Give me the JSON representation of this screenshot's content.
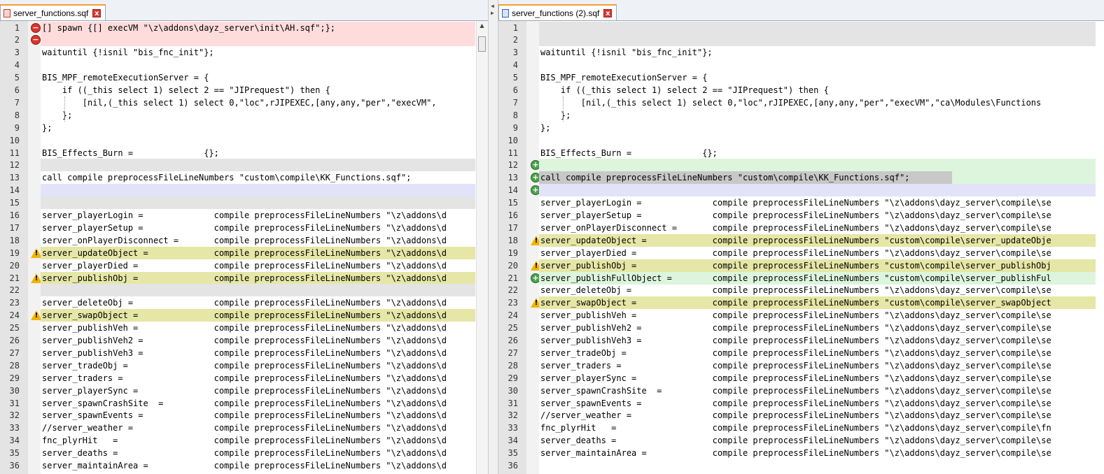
{
  "left": {
    "tab": {
      "title": "server_functions.sqf",
      "icon": "file-unsaved-icon",
      "close": "x"
    },
    "lines": [
      {
        "n": "1",
        "text": "[] spawn {[] execVM \"\\z\\addons\\dayz_server\\init\\AH.sqf\";};",
        "status": "deleted"
      },
      {
        "n": "2",
        "text": "",
        "status": "deleted"
      },
      {
        "n": "3",
        "text": "waituntil {!isnil \"bis_fnc_init\"};",
        "status": ""
      },
      {
        "n": "4",
        "text": "",
        "status": ""
      },
      {
        "n": "5",
        "text": "BIS_MPF_remoteExecutionServer = {",
        "status": ""
      },
      {
        "n": "6",
        "text": "    if ((_this select 1) select 2 == \"JIPrequest\") then {",
        "status": ""
      },
      {
        "n": "7",
        "text": "        [nil,(_this select 1) select 0,\"loc\",rJIPEXEC,[any,any,\"per\",\"execVM\",",
        "status": ""
      },
      {
        "n": "8",
        "text": "    };",
        "status": ""
      },
      {
        "n": "9",
        "text": "};",
        "status": ""
      },
      {
        "n": "10",
        "text": "",
        "status": ""
      },
      {
        "n": "11",
        "text": "BIS_Effects_Burn =              {};",
        "status": ""
      },
      {
        "n": "12",
        "text": "",
        "status": "blank"
      },
      {
        "n": "13",
        "text": "call compile preprocessFileLineNumbers \"custom\\compile\\KK_Functions.sqf\";",
        "status": ""
      },
      {
        "n": "14",
        "text": "",
        "status": "moved"
      },
      {
        "n": "15",
        "text": "",
        "status": "blank"
      },
      {
        "n": "16",
        "text": "server_playerLogin =              compile preprocessFileLineNumbers \"\\z\\addons\\d",
        "status": ""
      },
      {
        "n": "17",
        "text": "server_playerSetup =              compile preprocessFileLineNumbers \"\\z\\addons\\d",
        "status": ""
      },
      {
        "n": "18",
        "text": "server_onPlayerDisconnect =       compile preprocessFileLineNumbers \"\\z\\addons\\d",
        "status": ""
      },
      {
        "n": "19",
        "text": "server_updateObject =             compile preprocessFileLineNumbers \"\\z\\addons\\d",
        "status": "changed"
      },
      {
        "n": "20",
        "text": "server_playerDied =               compile preprocessFileLineNumbers \"\\z\\addons\\d",
        "status": ""
      },
      {
        "n": "21",
        "text": "server_publishObj =               compile preprocessFileLineNumbers \"\\z\\addons\\d",
        "status": "changed"
      },
      {
        "n": "22",
        "text": "",
        "status": "blank"
      },
      {
        "n": "23",
        "text": "server_deleteObj =                compile preprocessFileLineNumbers \"\\z\\addons\\d",
        "status": ""
      },
      {
        "n": "24",
        "text": "server_swapObject =               compile preprocessFileLineNumbers \"\\z\\addons\\d",
        "status": "changed"
      },
      {
        "n": "25",
        "text": "server_publishVeh =               compile preprocessFileLineNumbers \"\\z\\addons\\d",
        "status": ""
      },
      {
        "n": "26",
        "text": "server_publishVeh2 =              compile preprocessFileLineNumbers \"\\z\\addons\\d",
        "status": ""
      },
      {
        "n": "27",
        "text": "server_publishVeh3 =              compile preprocessFileLineNumbers \"\\z\\addons\\d",
        "status": ""
      },
      {
        "n": "28",
        "text": "server_tradeObj =                 compile preprocessFileLineNumbers \"\\z\\addons\\d",
        "status": ""
      },
      {
        "n": "29",
        "text": "server_traders =                  compile preprocessFileLineNumbers \"\\z\\addons\\d",
        "status": ""
      },
      {
        "n": "30",
        "text": "server_playerSync =               compile preprocessFileLineNumbers \"\\z\\addons\\d",
        "status": ""
      },
      {
        "n": "31",
        "text": "server_spawnCrashSite  =          compile preprocessFileLineNumbers \"\\z\\addons\\d",
        "status": ""
      },
      {
        "n": "32",
        "text": "server_spawnEvents =              compile preprocessFileLineNumbers \"\\z\\addons\\d",
        "status": ""
      },
      {
        "n": "33",
        "text": "//server_weather =                compile preprocessFileLineNumbers \"\\z\\addons\\d",
        "status": ""
      },
      {
        "n": "34",
        "text": "fnc_plyrHit   =                   compile preprocessFileLineNumbers \"\\z\\addons\\d",
        "status": ""
      },
      {
        "n": "35",
        "text": "server_deaths =                   compile preprocessFileLineNumbers \"\\z\\addons\\d",
        "status": ""
      },
      {
        "n": "36",
        "text": "server_maintainArea =             compile preprocessFileLineNumbers \"\\z\\addons\\d",
        "status": ""
      }
    ]
  },
  "right": {
    "tab": {
      "title": "server_functions (2).sqf",
      "icon": "file-saved-icon",
      "close": "x"
    },
    "lines": [
      {
        "n": "1",
        "text": "",
        "status": "blank"
      },
      {
        "n": "2",
        "text": "",
        "status": "blank"
      },
      {
        "n": "3",
        "text": "waituntil {!isnil \"bis_fnc_init\"};",
        "status": ""
      },
      {
        "n": "4",
        "text": "",
        "status": ""
      },
      {
        "n": "5",
        "text": "BIS_MPF_remoteExecutionServer = {",
        "status": ""
      },
      {
        "n": "6",
        "text": "    if ((_this select 1) select 2 == \"JIPrequest\") then {",
        "status": ""
      },
      {
        "n": "7",
        "text": "        [nil,(_this select 1) select 0,\"loc\",rJIPEXEC,[any,any,\"per\",\"execVM\",\"ca\\Modules\\Functions",
        "status": ""
      },
      {
        "n": "8",
        "text": "    };",
        "status": ""
      },
      {
        "n": "9",
        "text": "};",
        "status": ""
      },
      {
        "n": "10",
        "text": "",
        "status": ""
      },
      {
        "n": "11",
        "text": "BIS_Effects_Burn =              {};",
        "status": ""
      },
      {
        "n": "12",
        "text": "",
        "status": "added"
      },
      {
        "n": "13",
        "text": "call compile preprocessFileLineNumbers \"custom\\compile\\KK_Functions.sqf\";",
        "status": "added-sel"
      },
      {
        "n": "14",
        "text": "",
        "status": "added-moved"
      },
      {
        "n": "15",
        "text": "server_playerLogin =              compile preprocessFileLineNumbers \"\\z\\addons\\dayz_server\\compile\\se",
        "status": ""
      },
      {
        "n": "16",
        "text": "server_playerSetup =              compile preprocessFileLineNumbers \"\\z\\addons\\dayz_server\\compile\\se",
        "status": ""
      },
      {
        "n": "17",
        "text": "server_onPlayerDisconnect =       compile preprocessFileLineNumbers \"\\z\\addons\\dayz_server\\compile\\se",
        "status": ""
      },
      {
        "n": "18",
        "text": "server_updateObject =             compile preprocessFileLineNumbers \"custom\\compile\\server_updateObje",
        "status": "changed"
      },
      {
        "n": "19",
        "text": "server_playerDied =               compile preprocessFileLineNumbers \"\\z\\addons\\dayz_server\\compile\\se",
        "status": ""
      },
      {
        "n": "20",
        "text": "server_publishObj =               compile preprocessFileLineNumbers \"custom\\compile\\server_publishObj",
        "status": "changed"
      },
      {
        "n": "21",
        "text": "server_publishFullObject =        compile preprocessFileLineNumbers \"custom\\compile\\server_publishFul",
        "status": "added"
      },
      {
        "n": "22",
        "text": "server_deleteObj =                compile preprocessFileLineNumbers \"\\z\\addons\\dayz_server\\compile\\se",
        "status": ""
      },
      {
        "n": "23",
        "text": "server_swapObject =               compile preprocessFileLineNumbers \"custom\\compile\\server_swapObject",
        "status": "changed"
      },
      {
        "n": "24",
        "text": "server_publishVeh =               compile preprocessFileLineNumbers \"\\z\\addons\\dayz_server\\compile\\se",
        "status": ""
      },
      {
        "n": "25",
        "text": "server_publishVeh2 =              compile preprocessFileLineNumbers \"\\z\\addons\\dayz_server\\compile\\se",
        "status": ""
      },
      {
        "n": "26",
        "text": "server_publishVeh3 =              compile preprocessFileLineNumbers \"\\z\\addons\\dayz_server\\compile\\se",
        "status": ""
      },
      {
        "n": "27",
        "text": "server_tradeObj =                 compile preprocessFileLineNumbers \"\\z\\addons\\dayz_server\\compile\\se",
        "status": ""
      },
      {
        "n": "28",
        "text": "server_traders =                  compile preprocessFileLineNumbers \"\\z\\addons\\dayz_server\\compile\\se",
        "status": ""
      },
      {
        "n": "29",
        "text": "server_playerSync =               compile preprocessFileLineNumbers \"\\z\\addons\\dayz_server\\compile\\se",
        "status": ""
      },
      {
        "n": "30",
        "text": "server_spawnCrashSite  =          compile preprocessFileLineNumbers \"\\z\\addons\\dayz_server\\compile\\se",
        "status": ""
      },
      {
        "n": "31",
        "text": "server_spawnEvents =              compile preprocessFileLineNumbers \"\\z\\addons\\dayz_server\\compile\\se",
        "status": ""
      },
      {
        "n": "32",
        "text": "//server_weather =                compile preprocessFileLineNumbers \"\\z\\addons\\dayz_server\\compile\\se",
        "status": ""
      },
      {
        "n": "33",
        "text": "fnc_plyrHit   =                   compile preprocessFileLineNumbers \"\\z\\addons\\dayz_server\\compile\\fn",
        "status": ""
      },
      {
        "n": "34",
        "text": "server_deaths =                   compile preprocessFileLineNumbers \"\\z\\addons\\dayz_server\\compile\\se",
        "status": ""
      },
      {
        "n": "35",
        "text": "server_maintainArea =             compile preprocessFileLineNumbers \"\\z\\addons\\dayz_server\\compile\\se",
        "status": ""
      },
      {
        "n": "36",
        "text": "",
        "status": ""
      }
    ]
  },
  "colors": {
    "deleted": "#ffdcdc",
    "added": "#dcf5dc",
    "changed": "#e6e6a6",
    "moved": "#e2e2f8",
    "blank": "#e4e4e4"
  }
}
